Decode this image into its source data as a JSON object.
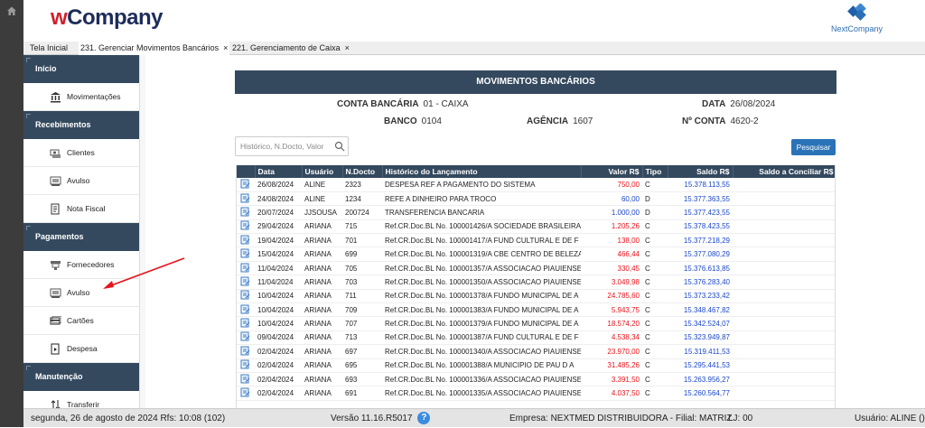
{
  "header": {
    "logo_prefix": "w",
    "logo_text": "Company",
    "brand_right": "NextCompany"
  },
  "tabs": [
    {
      "label": "Tela Inicial"
    },
    {
      "label": "231. Gerenciar Movimentos Bancários",
      "close": "×"
    },
    {
      "label": "221. Gerenciamento de Caixa",
      "close": "×"
    }
  ],
  "sidebar": {
    "sections": [
      {
        "title": "Início",
        "items": [
          {
            "label": "Movimentações",
            "icon": "bank-icon"
          }
        ]
      },
      {
        "title": "Recebimentos",
        "items": [
          {
            "label": "Clientes",
            "icon": "clients-icon"
          },
          {
            "label": "Avulso",
            "icon": "cash-icon"
          },
          {
            "label": "Nota Fiscal",
            "icon": "invoice-icon"
          }
        ]
      },
      {
        "title": "Pagamentos",
        "items": [
          {
            "label": "Fornecedores",
            "icon": "supplier-icon"
          },
          {
            "label": "Avulso",
            "icon": "cash-icon"
          },
          {
            "label": "Cartões",
            "icon": "card-icon"
          },
          {
            "label": "Despesa",
            "icon": "expense-icon"
          }
        ]
      },
      {
        "title": "Manutenção",
        "items": [
          {
            "label": "Transferir",
            "icon": "transfer-icon"
          }
        ]
      }
    ]
  },
  "panel": {
    "title": "MOVIMENTOS BANCÁRIOS",
    "conta_label": "CONTA BANCÁRIA",
    "conta_value": "01 - CAIXA",
    "data_label": "DATA",
    "data_value": "26/08/2024",
    "banco_label": "BANCO",
    "banco_value": "0104",
    "agencia_label": "AGÊNCIA",
    "agencia_value": "1607",
    "nconta_label": "Nº CONTA",
    "nconta_value": "4620-2"
  },
  "search": {
    "placeholder": "Histórico, N.Docto, Valor",
    "button": "Pesquisar"
  },
  "table": {
    "headers": [
      "",
      "Data",
      "Usuário",
      "N.Docto",
      "Histórico do Lançamento",
      "Valor R$",
      "Tipo",
      "Saldo R$",
      "Saldo a Conciliar R$"
    ],
    "rows": [
      [
        "26/08/2024",
        "ALINE",
        "2323",
        "DESPESA REF A PAGAMENTO DO SISTEMA",
        "750,00",
        "C",
        "15.378.113,55"
      ],
      [
        "24/08/2024",
        "ALINE",
        "1234",
        "REFE A DINHEIRO PARA TROCO",
        "60,00",
        "D",
        "15.377.363,55"
      ],
      [
        "20/07/2024",
        "JJSOUSA",
        "200724",
        "TRANSFERENCIA BANCARIA",
        "1.000,00",
        "D",
        "15.377.423,55"
      ],
      [
        "29/04/2024",
        "ARIANA",
        "715",
        "Ref.CR.Doc.BL No. 100001426/A SOCIEDADE BRASILEIRA",
        "1.205,26",
        "C",
        "15.378.423,55"
      ],
      [
        "19/04/2024",
        "ARIANA",
        "701",
        "Ref.CR.Doc.BL No. 100001417/A FUND CULTURAL E DE F",
        "138,00",
        "C",
        "15.377.218,29"
      ],
      [
        "15/04/2024",
        "ARIANA",
        "699",
        "Ref.CR.Doc.BL No. 100001319/A CBE CENTRO DE BELEZA",
        "466,44",
        "C",
        "15.377.080,29"
      ],
      [
        "11/04/2024",
        "ARIANA",
        "705",
        "Ref.CR.Doc.BL No. 100001357/A ASSOCIACAO PIAUIENSE",
        "330,45",
        "C",
        "15.376.613,85"
      ],
      [
        "11/04/2024",
        "ARIANA",
        "703",
        "Ref.CR.Doc.BL No. 100001350/A ASSOCIACAO PIAUIENSE",
        "3.049,98",
        "C",
        "15.376.283,40"
      ],
      [
        "10/04/2024",
        "ARIANA",
        "711",
        "Ref.CR.Doc.BL No. 100001378/A FUNDO MUNICIPAL DE A",
        "24.785,60",
        "C",
        "15.373.233,42"
      ],
      [
        "10/04/2024",
        "ARIANA",
        "709",
        "Ref.CR.Doc.BL No. 100001383/A FUNDO MUNICIPAL DE A",
        "5.943,75",
        "C",
        "15.348.467,82"
      ],
      [
        "10/04/2024",
        "ARIANA",
        "707",
        "Ref.CR.Doc.BL No. 100001379/A FUNDO MUNICIPAL DE A",
        "18.574,20",
        "C",
        "15.342.524,07"
      ],
      [
        "09/04/2024",
        "ARIANA",
        "713",
        "Ref.CR.Doc.BL No. 100001387/A FUND CULTURAL E DE F",
        "4.538,34",
        "C",
        "15.323.949,87"
      ],
      [
        "02/04/2024",
        "ARIANA",
        "697",
        "Ref.CR.Doc.BL No. 100001340/A ASSOCIACAO PIAUIENSE",
        "23.970,00",
        "C",
        "15.319.411,53"
      ],
      [
        "02/04/2024",
        "ARIANA",
        "695",
        "Ref.CR.Doc.BL No. 100001388/A MUNICIPIO DE PAU D A",
        "31.485,26",
        "C",
        "15.295.441,53"
      ],
      [
        "02/04/2024",
        "ARIANA",
        "693",
        "Ref.CR.Doc.BL No. 100001336/A ASSOCIACAO PIAUIENSE",
        "3.391,50",
        "C",
        "15.263.956,27"
      ],
      [
        "02/04/2024",
        "ARIANA",
        "691",
        "Ref.CR.Doc.BL No. 100001335/A ASSOCIACAO PIAUIENSE",
        "4.037,50",
        "C",
        "15.260.564,77"
      ]
    ]
  },
  "status": {
    "date": "segunda, 26 de agosto de 2024  Rfs: 10:08 (102)",
    "version": "Versão 11.16.R5017",
    "help": "?",
    "company": "Empresa: NEXTMED DISTRIBUIDORA - Filial: MATRIZ",
    "lj": "LJ: 00",
    "user": "Usuário: ALINE ()"
  },
  "colors": {
    "navy": "#34495e",
    "accent_blue": "#2b73b7",
    "value_red": "#e8141b",
    "value_blue": "#1a47c8",
    "logo_red": "#d1202a",
    "logo_navy": "#1e2c5a"
  }
}
